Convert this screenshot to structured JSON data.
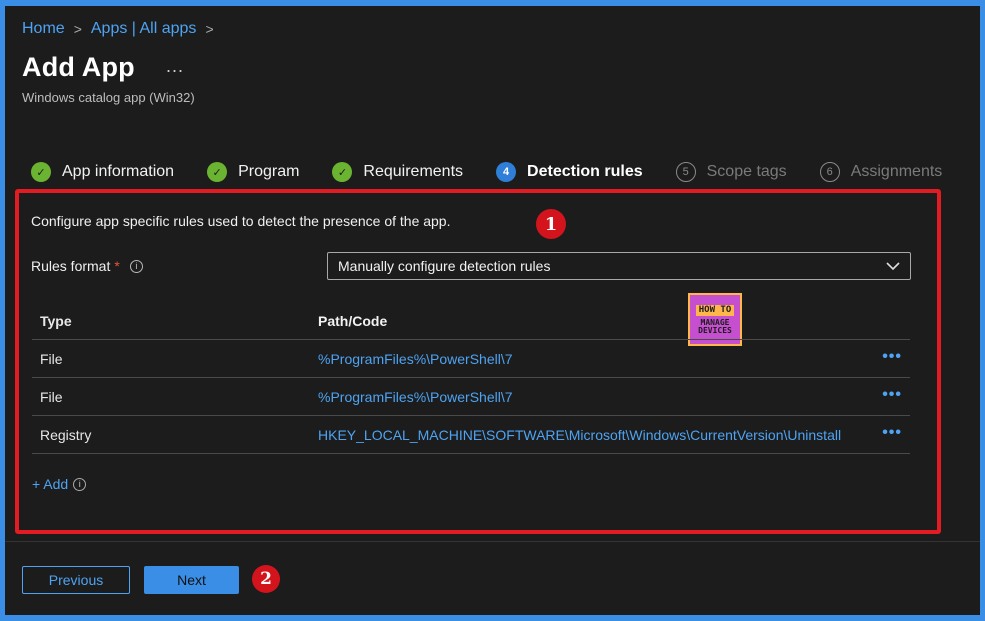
{
  "breadcrumb": {
    "home": "Home",
    "apps": "Apps | All apps",
    "sep": ">"
  },
  "header": {
    "title": "Add App",
    "more": "...",
    "subtitle": "Windows catalog app (Win32)"
  },
  "steps": [
    {
      "label": "App information",
      "state": "done",
      "marker": "✓"
    },
    {
      "label": "Program",
      "state": "done",
      "marker": "✓"
    },
    {
      "label": "Requirements",
      "state": "done",
      "marker": "✓"
    },
    {
      "label": "Detection rules",
      "state": "current",
      "marker": "4"
    },
    {
      "label": "Scope tags",
      "state": "todo",
      "marker": "5"
    },
    {
      "label": "Assignments",
      "state": "todo",
      "marker": "6"
    }
  ],
  "main": {
    "description": "Configure app specific rules used to detect the presence of the app.",
    "rules_format": {
      "label": "Rules format",
      "required_mark": "*",
      "info": "i",
      "selected": "Manually configure detection rules"
    },
    "table": {
      "headers": {
        "type": "Type",
        "path": "Path/Code"
      },
      "rows": [
        {
          "type": "File",
          "path": "%ProgramFiles%\\PowerShell\\7",
          "more": "•••"
        },
        {
          "type": "File",
          "path": "%ProgramFiles%\\PowerShell\\7",
          "more": "•••"
        },
        {
          "type": "Registry",
          "path": "HKEY_LOCAL_MACHINE\\SOFTWARE\\Microsoft\\Windows\\CurrentVersion\\Uninstall",
          "more": "•••"
        }
      ]
    },
    "add_label": "+ Add",
    "add_info": "i"
  },
  "annotations": {
    "badge_1": "1",
    "badge_2": "2"
  },
  "watermark": {
    "line1": "HOW TO",
    "line2": "MANAGE",
    "line3": "DEVICES"
  },
  "footer": {
    "previous_label": "Previous",
    "next_label": "Next"
  },
  "colors": {
    "accent": "#3a8ee6",
    "link": "#4ea3f2",
    "done": "#6bb431",
    "highlight": "#e31b23"
  }
}
